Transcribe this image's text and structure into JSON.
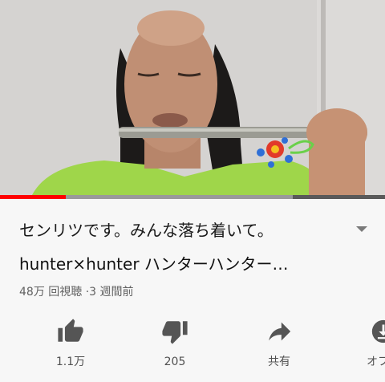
{
  "video": {
    "progress_fraction": 0.17,
    "buffered_fraction": 0.76
  },
  "title": "センリツです。みんな落ち着いて。",
  "subtitle": "hunter×hunter ハンターハンター…",
  "meta": {
    "views": "48万 回視聴",
    "age": "3 週間前"
  },
  "actions": [
    {
      "label": "1.1万",
      "icon": "thumbs-up-icon"
    },
    {
      "label": "205",
      "icon": "thumbs-down-icon"
    },
    {
      "label": "共有",
      "icon": "share-icon"
    },
    {
      "label": "オフラ",
      "icon": "download-icon"
    }
  ],
  "colors": {
    "progress": "#ff0000",
    "icon": "#555555",
    "meta_text": "#606060"
  }
}
